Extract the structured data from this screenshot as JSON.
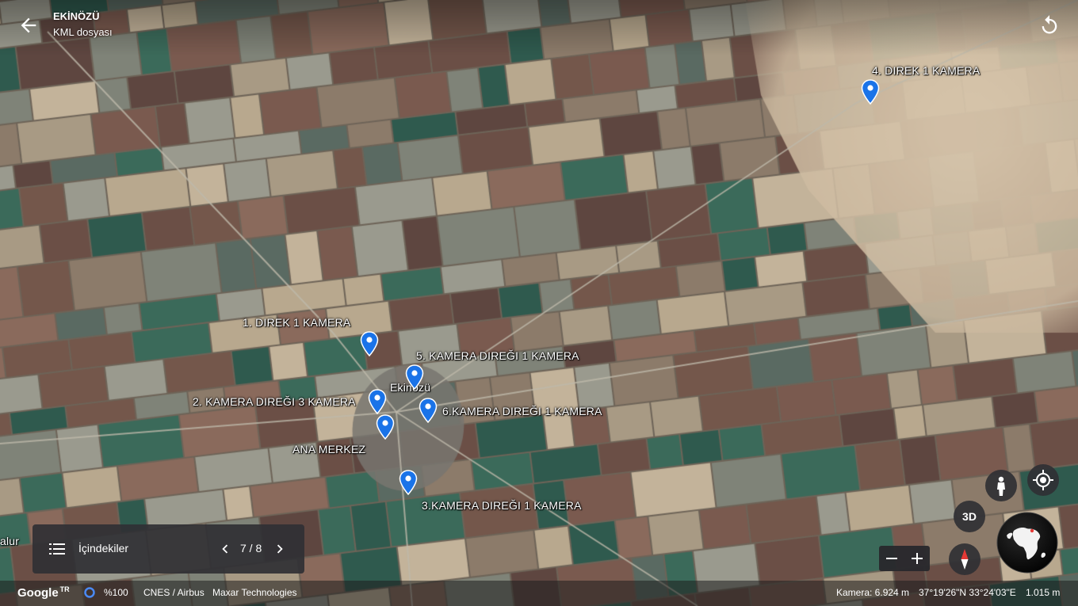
{
  "header": {
    "title": "EKİNÖZÜ",
    "subtitle": "KML dosyası"
  },
  "map": {
    "place_labels": [
      {
        "text": "Ekinözü"
      },
      {
        "text": "ANA MERKEZ"
      },
      {
        "text": "alur"
      }
    ],
    "placemarks": [
      {
        "label": "1. DIREK 1 KAMERA"
      },
      {
        "label": "2. KAMERA DIREĞI 3 KAMERA"
      },
      {
        "label": "3.KAMERA DIREĞI 1 KAMERA"
      },
      {
        "label": "4. DIREK 1 KAMERA"
      },
      {
        "label": "5. KAMERA DIREĞI 1 KAMERA"
      },
      {
        "label": "6.KAMERA DIREĞI 1 KAMERA"
      }
    ],
    "pin_color": "#1a73e8"
  },
  "toc": {
    "label": "İçindekiler",
    "page": "7 / 8"
  },
  "controls": {
    "three_d": "3D"
  },
  "footer": {
    "google": "Google",
    "tr": "TR",
    "quality": "%100",
    "credits": "CNES / Airbus",
    "credits2": "Maxar Technologies",
    "camera": "Kamera: 6.924 m",
    "coords": "37°19'26\"N 33°24'03\"E",
    "elevation": "1.015 m"
  },
  "icons": [
    "back-arrow-icon",
    "reset-rotation-icon",
    "list-icon",
    "chevron-left-icon",
    "chevron-right-icon",
    "pegman-icon",
    "my-location-icon",
    "compass-icon",
    "minus-icon",
    "plus-icon",
    "globe-icon",
    "map-pin-icon"
  ]
}
